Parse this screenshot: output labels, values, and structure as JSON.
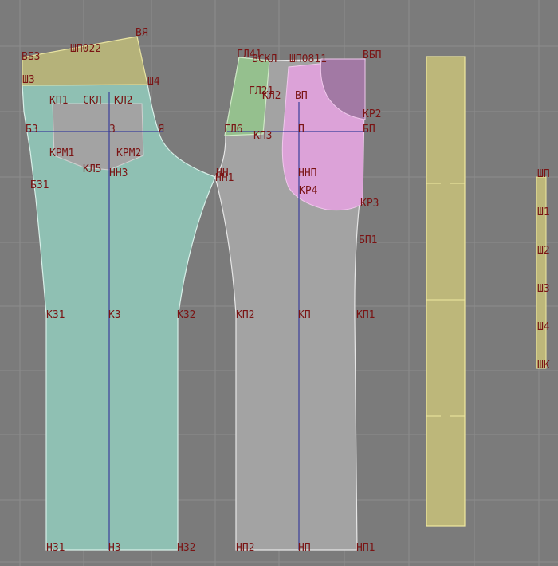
{
  "colors": {
    "background": "#7b7b7b",
    "grid": "#8d8d8d",
    "back_piece_fill": "#8fc0b3",
    "front_piece_fill": "#a3a3a3",
    "yoke_fill": "#b5b27a",
    "facing_fill": "#95c08e",
    "pocket_fill": "#dca2d8",
    "pocket_dark_fill": "#a279a4",
    "waistband_fill": "#bdb77a",
    "label": "#7a1414",
    "axis_line": "#3a3f9a"
  },
  "labels": {
    "back_yoke": [
      "ВБЗ",
      "ШП022",
      "ВЯ",
      "Ш3",
      "Ш4"
    ],
    "back_pocket": [
      "КП1",
      "СКЛ",
      "КЛ2",
      "КРМ1",
      "КРМ2",
      "КЛ5"
    ],
    "back_piece": [
      "БЗ",
      "З",
      "Я",
      "ННЗ",
      "БЗ1",
      "КЗ1",
      "КЗ",
      "КЗ2",
      "НЗ1",
      "НЗ",
      "НЗ2"
    ],
    "fly_facing": [
      "ГЛ41",
      "ГЛ21",
      "КЛ2",
      "ГЛ6",
      "КП3"
    ],
    "front_top": [
      "ВСКЛ",
      "ШП0811",
      "ВБП"
    ],
    "front_piece": [
      "ВП",
      "КР2",
      "П",
      "БП",
      "НН",
      "НН1",
      "ННП",
      "КР4",
      "КР3",
      "БП1",
      "КП2",
      "КП",
      "КП1",
      "НП2",
      "НП",
      "НП1"
    ],
    "belt": [
      "ШП",
      "Ш1",
      "Ш2",
      "Ш3",
      "Ш4",
      "ШК"
    ]
  }
}
